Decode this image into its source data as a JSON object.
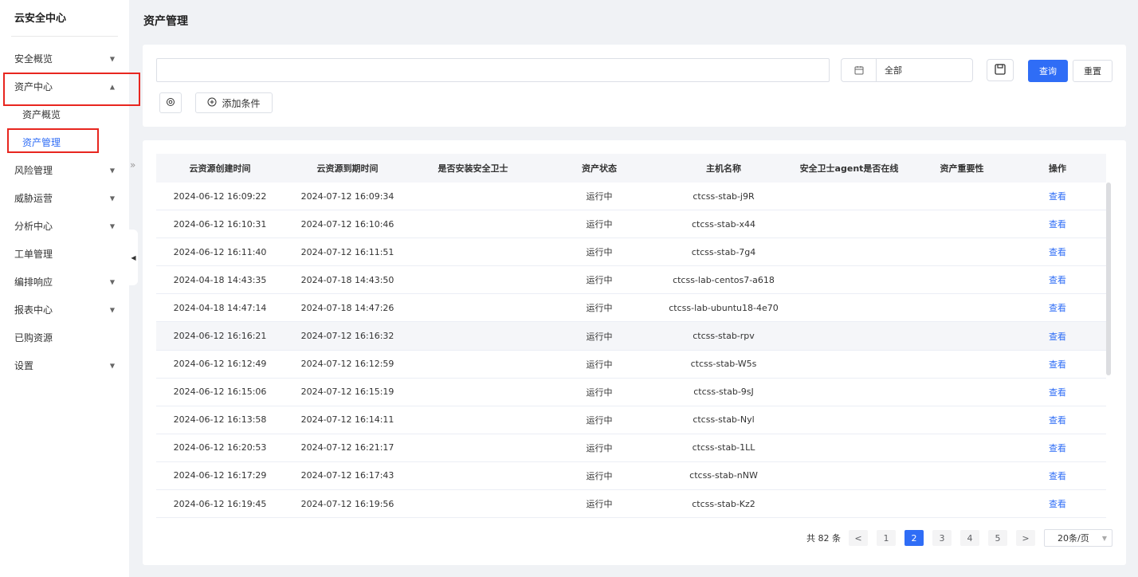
{
  "sidebar": {
    "brand": "云安全中心",
    "items": [
      {
        "label": "安全概览",
        "has_caret": true
      },
      {
        "label": "资产中心",
        "has_caret": true
      },
      {
        "label": "资产概览",
        "sub": true
      },
      {
        "label": "资产管理",
        "sub": true,
        "active": true
      },
      {
        "label": "风险管理",
        "has_caret": true
      },
      {
        "label": "威胁运营",
        "has_caret": true
      },
      {
        "label": "分析中心",
        "has_caret": true
      },
      {
        "label": "工单管理",
        "has_caret": false
      },
      {
        "label": "编排响应",
        "has_caret": true
      },
      {
        "label": "报表中心",
        "has_caret": true
      },
      {
        "label": "已购资源",
        "has_caret": false
      },
      {
        "label": "设置",
        "has_caret": true
      }
    ],
    "caret_down": "▼",
    "caret_up": "▲",
    "collapse_glyph": "◀",
    "expand_glyph": "»"
  },
  "page": {
    "title": "资产管理"
  },
  "filter": {
    "search_value": "",
    "date_value": "全部",
    "query_label": "查询",
    "reset_label": "重置",
    "add_condition_label": "添加条件"
  },
  "table": {
    "columns": [
      "云资源创建时间",
      "云资源到期时间",
      "是否安装安全卫士",
      "资产状态",
      "主机名称",
      "安全卫士agent是否在线",
      "资产重要性",
      "操作"
    ],
    "rows": [
      {
        "created": "2024-06-12 16:09:22",
        "expires": "2024-07-12 16:09:34",
        "installed": "",
        "status": "运行中",
        "host": "ctcss-stab-j9R",
        "online": "",
        "importance": "",
        "action": "查看"
      },
      {
        "created": "2024-06-12 16:10:31",
        "expires": "2024-07-12 16:10:46",
        "installed": "",
        "status": "运行中",
        "host": "ctcss-stab-x44",
        "online": "",
        "importance": "",
        "action": "查看"
      },
      {
        "created": "2024-06-12 16:11:40",
        "expires": "2024-07-12 16:11:51",
        "installed": "",
        "status": "运行中",
        "host": "ctcss-stab-7g4",
        "online": "",
        "importance": "",
        "action": "查看"
      },
      {
        "created": "2024-04-18 14:43:35",
        "expires": "2024-07-18 14:43:50",
        "installed": "",
        "status": "运行中",
        "host": "ctcss-lab-centos7-a618",
        "online": "",
        "importance": "",
        "action": "查看"
      },
      {
        "created": "2024-04-18 14:47:14",
        "expires": "2024-07-18 14:47:26",
        "installed": "",
        "status": "运行中",
        "host": "ctcss-lab-ubuntu18-4e70",
        "online": "",
        "importance": "",
        "action": "查看"
      },
      {
        "created": "2024-06-12 16:16:21",
        "expires": "2024-07-12 16:16:32",
        "installed": "",
        "status": "运行中",
        "host": "ctcss-stab-rpv",
        "online": "",
        "importance": "",
        "action": "查看"
      },
      {
        "created": "2024-06-12 16:12:49",
        "expires": "2024-07-12 16:12:59",
        "installed": "",
        "status": "运行中",
        "host": "ctcss-stab-W5s",
        "online": "",
        "importance": "",
        "action": "查看"
      },
      {
        "created": "2024-06-12 16:15:06",
        "expires": "2024-07-12 16:15:19",
        "installed": "",
        "status": "运行中",
        "host": "ctcss-stab-9sJ",
        "online": "",
        "importance": "",
        "action": "查看"
      },
      {
        "created": "2024-06-12 16:13:58",
        "expires": "2024-07-12 16:14:11",
        "installed": "",
        "status": "运行中",
        "host": "ctcss-stab-Nyl",
        "online": "",
        "importance": "",
        "action": "查看"
      },
      {
        "created": "2024-06-12 16:20:53",
        "expires": "2024-07-12 16:21:17",
        "installed": "",
        "status": "运行中",
        "host": "ctcss-stab-1LL",
        "online": "",
        "importance": "",
        "action": "查看"
      },
      {
        "created": "2024-06-12 16:17:29",
        "expires": "2024-07-12 16:17:43",
        "installed": "",
        "status": "运行中",
        "host": "ctcss-stab-nNW",
        "online": "",
        "importance": "",
        "action": "查看"
      },
      {
        "created": "2024-06-12 16:19:45",
        "expires": "2024-07-12 16:19:56",
        "installed": "",
        "status": "运行中",
        "host": "ctcss-stab-Kz2",
        "online": "",
        "importance": "",
        "action": "查看"
      }
    ]
  },
  "pagination": {
    "total": "共 82 条",
    "prev": "<",
    "next": ">",
    "pages": [
      "1",
      "2",
      "3",
      "4",
      "5"
    ],
    "current_page": "2",
    "page_size": "20条/页"
  },
  "colors": {
    "accent": "#2f6df6",
    "highlight_box": "#e8261f",
    "background": "#f0f2f5"
  }
}
